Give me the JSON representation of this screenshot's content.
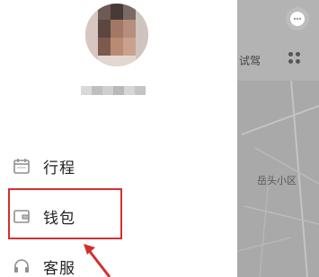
{
  "drawer": {
    "menu": [
      {
        "id": "trips",
        "label": "行程",
        "icon": "calendar-icon"
      },
      {
        "id": "wallet",
        "label": "钱包",
        "icon": "wallet-icon"
      },
      {
        "id": "service",
        "label": "客服",
        "icon": "headset-icon"
      }
    ],
    "highlighted_item": "wallet",
    "highlight_color": "#d32f2f"
  },
  "map": {
    "tab_label": "试驾",
    "place_label": "岳头小区",
    "icons": [
      "chat-icon",
      "grid-icon"
    ]
  }
}
